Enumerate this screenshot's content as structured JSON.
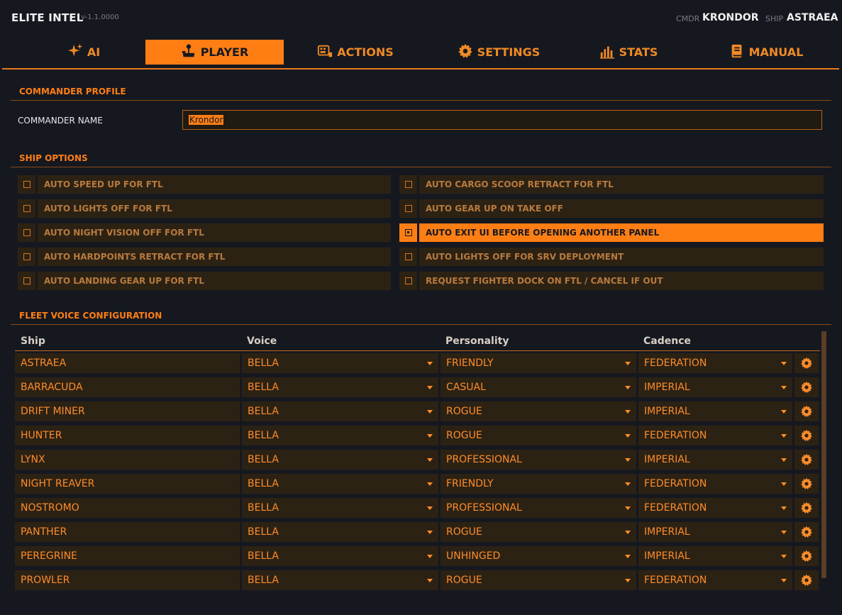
{
  "app": {
    "title": "ELITE INTEL",
    "version": "v-1.1.0000",
    "cmdr_label": "CMDR",
    "cmdr_value": "KRONDOR",
    "ship_label": "SHIP",
    "ship_value": "ASTRAEA"
  },
  "tabs": [
    {
      "label": "AI",
      "icon": "sparkle-icon",
      "active": false
    },
    {
      "label": "PLAYER",
      "icon": "joystick-icon",
      "active": true
    },
    {
      "label": "ACTIONS",
      "icon": "keyboard-icon",
      "active": false
    },
    {
      "label": "SETTINGS",
      "icon": "gear-icon",
      "active": false
    },
    {
      "label": "STATS",
      "icon": "bar-chart-icon",
      "active": false
    },
    {
      "label": "MANUAL",
      "icon": "book-icon",
      "active": false
    }
  ],
  "commander_profile": {
    "title": "COMMANDER PROFILE",
    "name_label": "COMMANDER NAME",
    "name_value": "Krondor"
  },
  "ship_options": {
    "title": "SHIP OPTIONS",
    "left": [
      {
        "label": "AUTO SPEED UP FOR FTL",
        "checked": false
      },
      {
        "label": "AUTO LIGHTS OFF FOR FTL",
        "checked": false
      },
      {
        "label": "AUTO NIGHT VISION OFF FOR FTL",
        "checked": false
      },
      {
        "label": "AUTO HARDPOINTS RETRACT FOR FTL",
        "checked": false
      },
      {
        "label": "AUTO LANDING GEAR UP FOR FTL",
        "checked": false
      }
    ],
    "right": [
      {
        "label": "AUTO CARGO SCOOP RETRACT FOR FTL",
        "checked": false
      },
      {
        "label": "AUTO GEAR UP ON TAKE OFF",
        "checked": false
      },
      {
        "label": "AUTO EXIT UI BEFORE OPENING ANOTHER PANEL",
        "checked": true
      },
      {
        "label": "AUTO LIGHTS OFF FOR SRV DEPLOYMENT",
        "checked": false
      },
      {
        "label": "REQUEST FIGHTER DOCK ON FTL / CANCEL IF OUT",
        "checked": false
      }
    ]
  },
  "fleet": {
    "title": "FLEET VOICE CONFIGURATION",
    "columns": [
      "Ship",
      "Voice",
      "Personality",
      "Cadence"
    ],
    "rows": [
      {
        "ship": "ASTRAEA",
        "voice": "BELLA",
        "personality": "FRIENDLY",
        "cadence": "FEDERATION"
      },
      {
        "ship": "BARRACUDA",
        "voice": "BELLA",
        "personality": "CASUAL",
        "cadence": "IMPERIAL"
      },
      {
        "ship": "DRIFT MINER",
        "voice": "BELLA",
        "personality": "ROGUE",
        "cadence": "IMPERIAL"
      },
      {
        "ship": "HUNTER",
        "voice": "BELLA",
        "personality": "ROGUE",
        "cadence": "FEDERATION"
      },
      {
        "ship": "LYNX",
        "voice": "BELLA",
        "personality": "PROFESSIONAL",
        "cadence": "IMPERIAL"
      },
      {
        "ship": "NIGHT REAVER",
        "voice": "BELLA",
        "personality": "FRIENDLY",
        "cadence": "FEDERATION"
      },
      {
        "ship": "NOSTROMO",
        "voice": "BELLA",
        "personality": "PROFESSIONAL",
        "cadence": "FEDERATION"
      },
      {
        "ship": "PANTHER",
        "voice": "BELLA",
        "personality": "ROGUE",
        "cadence": "IMPERIAL"
      },
      {
        "ship": "PEREGRINE",
        "voice": "BELLA",
        "personality": "UNHINGED",
        "cadence": "IMPERIAL"
      },
      {
        "ship": "PROWLER",
        "voice": "BELLA",
        "personality": "ROGUE",
        "cadence": "FEDERATION"
      }
    ]
  },
  "colors": {
    "accent": "#ff7e14",
    "background": "#161820",
    "panel": "#2c2214"
  }
}
